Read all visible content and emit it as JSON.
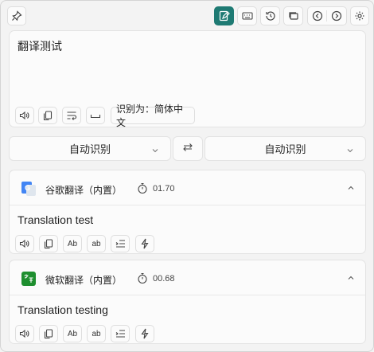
{
  "toolbar": {
    "pin_icon": "pin-icon",
    "buttons": [
      {
        "icon": "edit-note-icon",
        "active": true
      },
      {
        "icon": "keyboard-icon"
      },
      {
        "icon": "history-icon"
      },
      {
        "icon": "windows-icon"
      },
      {
        "icon": "chevron-left-circle-icon"
      },
      {
        "icon": "chevron-right-circle-icon"
      },
      {
        "icon": "settings-icon"
      }
    ],
    "accent": "#1e7a73"
  },
  "source": {
    "text": "翻译测试",
    "detected_label": "识别为：简体中文"
  },
  "languages": {
    "from": "自动识别",
    "to": "自动识别"
  },
  "services": [
    {
      "name": "谷歌翻译（内置）",
      "time": "01.70",
      "result": "Translation test",
      "logo_color": "#4285f4"
    },
    {
      "name": "微软翻译（内置）",
      "time": "00.68",
      "result": "Translation testing",
      "logo_color": "#1e8f2f"
    }
  ],
  "action_labels": {
    "case_upper": "Ab",
    "case_lower": "ab"
  }
}
